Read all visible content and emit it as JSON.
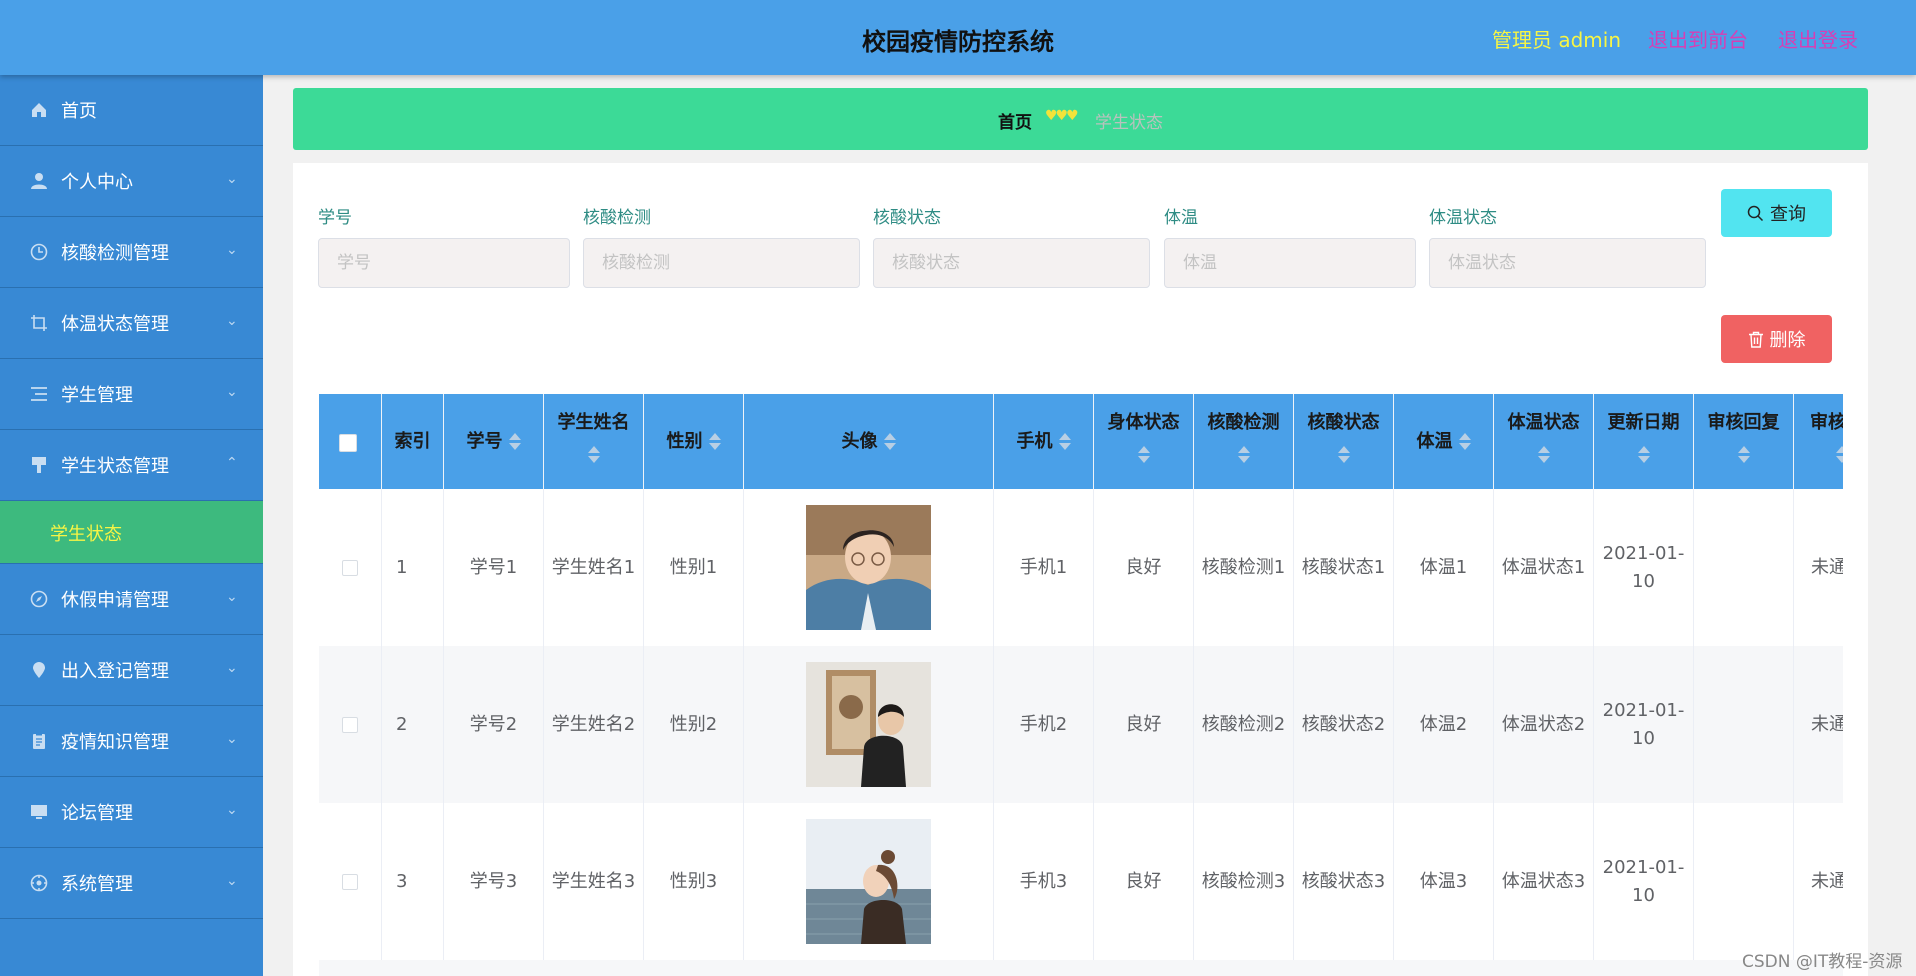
{
  "header": {
    "title": "校园疫情防控系统",
    "user": "管理员 admin",
    "to_front": "退出到前台",
    "logout": "退出登录"
  },
  "sidebar": {
    "items": [
      {
        "label": "首页",
        "icon": "home-icon",
        "expandable": false
      },
      {
        "label": "个人中心",
        "icon": "user-icon",
        "expandable": true
      },
      {
        "label": "核酸检测管理",
        "icon": "clock-icon",
        "expandable": true
      },
      {
        "label": "体温状态管理",
        "icon": "crop-icon",
        "expandable": true
      },
      {
        "label": "学生管理",
        "icon": "list-icon",
        "expandable": true
      },
      {
        "label": "学生状态管理",
        "icon": "brush-icon",
        "expandable": true,
        "expanded": true
      },
      {
        "label": "休假申请管理",
        "icon": "compass-icon",
        "expandable": true
      },
      {
        "label": "出入登记管理",
        "icon": "location-icon",
        "expandable": true
      },
      {
        "label": "疫情知识管理",
        "icon": "clipboard-icon",
        "expandable": true
      },
      {
        "label": "论坛管理",
        "icon": "monitor-icon",
        "expandable": true
      },
      {
        "label": "系统管理",
        "icon": "settings-icon",
        "expandable": true
      }
    ],
    "active_sub": "学生状态"
  },
  "breadcrumb": {
    "home": "首页",
    "separator": "♥♥♥",
    "current": "学生状态"
  },
  "search": {
    "fields": [
      {
        "label": "学号",
        "placeholder": "学号",
        "value": ""
      },
      {
        "label": "核酸检测",
        "placeholder": "核酸检测",
        "value": ""
      },
      {
        "label": "核酸状态",
        "placeholder": "核酸状态",
        "value": ""
      },
      {
        "label": "体温",
        "placeholder": "体温",
        "value": ""
      },
      {
        "label": "体温状态",
        "placeholder": "体温状态",
        "value": ""
      }
    ],
    "query_button": "查询",
    "delete_button": "删除"
  },
  "table": {
    "columns": [
      "索引",
      "学号",
      "学生姓名",
      "性别",
      "头像",
      "手机",
      "身体状态",
      "核酸检测",
      "核酸状态",
      "体温",
      "体温状态",
      "更新日期",
      "审核回复",
      "审核"
    ],
    "rows": [
      {
        "index": "1",
        "student_id": "学号1",
        "name": "学生姓名1",
        "gender": "性别1",
        "phone": "手机1",
        "body_status": "良好",
        "nucleic_test": "核酸检测1",
        "nucleic_status": "核酸状态1",
        "temperature": "体温1",
        "temp_status": "体温状态1",
        "updated": "2021-01-10",
        "review_reply": "",
        "review": "未通"
      },
      {
        "index": "2",
        "student_id": "学号2",
        "name": "学生姓名2",
        "gender": "性别2",
        "phone": "手机2",
        "body_status": "良好",
        "nucleic_test": "核酸检测2",
        "nucleic_status": "核酸状态2",
        "temperature": "体温2",
        "temp_status": "体温状态2",
        "updated": "2021-01-10",
        "review_reply": "",
        "review": "未通"
      },
      {
        "index": "3",
        "student_id": "学号3",
        "name": "学生姓名3",
        "gender": "性别3",
        "phone": "手机3",
        "body_status": "良好",
        "nucleic_test": "核酸检测3",
        "nucleic_status": "核酸状态3",
        "temperature": "体温3",
        "temp_status": "体温状态3",
        "updated": "2021-01-10",
        "review_reply": "",
        "review": "未通"
      }
    ]
  },
  "watermark": "CSDN @IT教程-资源"
}
